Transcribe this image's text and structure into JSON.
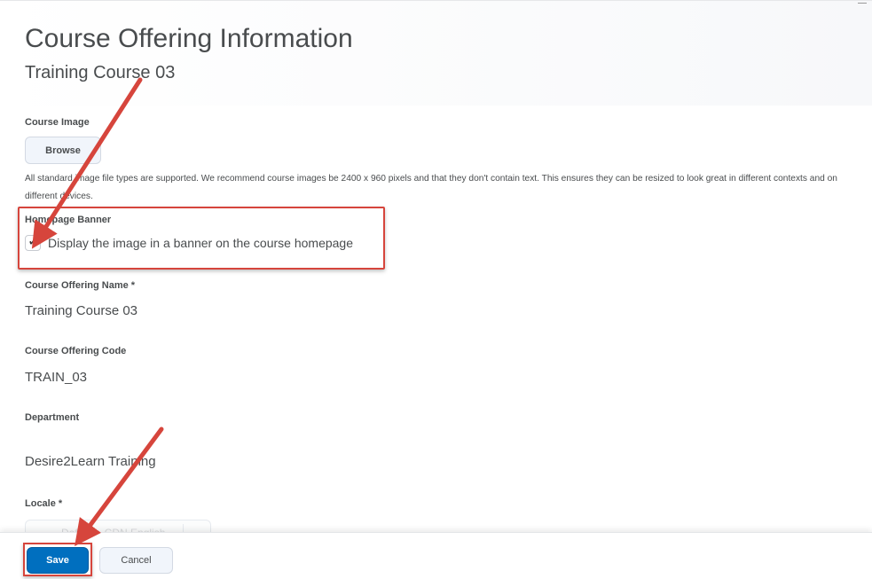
{
  "header": {
    "title": "Course Offering Information",
    "subtitle": "Training Course 03"
  },
  "course_image": {
    "label": "Course Image",
    "browse_label": "Browse",
    "help_text": "All standard image file types are supported. We recommend course images be 2400 x 960 pixels and that they don't contain text. This ensures they can be resized to look great in different contexts and on different devices."
  },
  "homepage_banner": {
    "label": "Homepage Banner",
    "checkbox_label": "Display the image in a banner on the course homepage",
    "checked": true
  },
  "offering_name": {
    "label": "Course Offering Name *",
    "value": "Training Course 03"
  },
  "offering_code": {
    "label": "Course Offering Code",
    "value": "TRAIN_03"
  },
  "department": {
    "label": "Department",
    "value": "Desire2Learn Training"
  },
  "locale": {
    "label": "Locale *",
    "selected": "Default - CDN English"
  },
  "footer": {
    "save_label": "Save",
    "cancel_label": "Cancel"
  },
  "colors": {
    "primary": "#006fbf",
    "annotation": "#d6453c"
  }
}
